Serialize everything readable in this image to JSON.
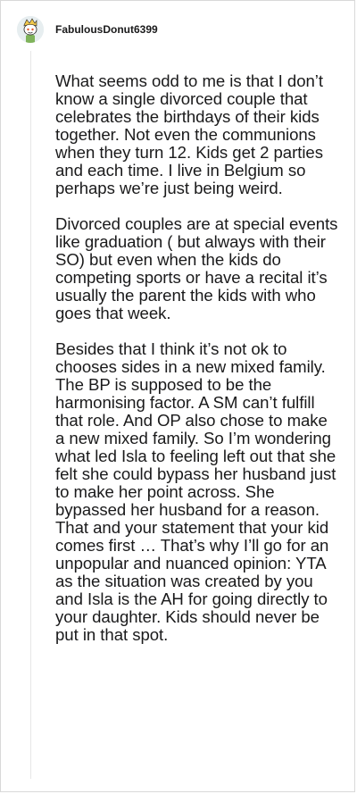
{
  "comment": {
    "username": "FabulousDonut6399",
    "avatar_icon": "snoo-avatar-icon",
    "paragraphs": [
      "What seems odd to me is that I don’t know a single divorced couple that celebrates the birthdays of their kids together. Not even the communions when they turn 12. Kids get 2 parties and each time. I live in Belgium so perhaps we’re just being weird.",
      "Divorced couples are at special events like graduation ( but always with their SO) but even when the kids do competing sports or have a recital it’s usually the parent the kids with who goes that week.",
      "Besides that I think it’s not ok to chooses sides in a new mixed family. The BP is supposed to be the harmonising factor. A SM can’t fulfill that role. And OP also chose to make a new mixed family. So I’m wondering what led Isla to feeling left out that she felt she could bypass her husband just to make her point across. She bypassed her husband for a reason. That and your statement that your kid comes first … That’s why I’ll go for an unpopular and nuanced opinion: YTA as the situation was created by you and Isla is the AH for going directly to your daughter. Kids should never be put in that spot."
    ]
  }
}
